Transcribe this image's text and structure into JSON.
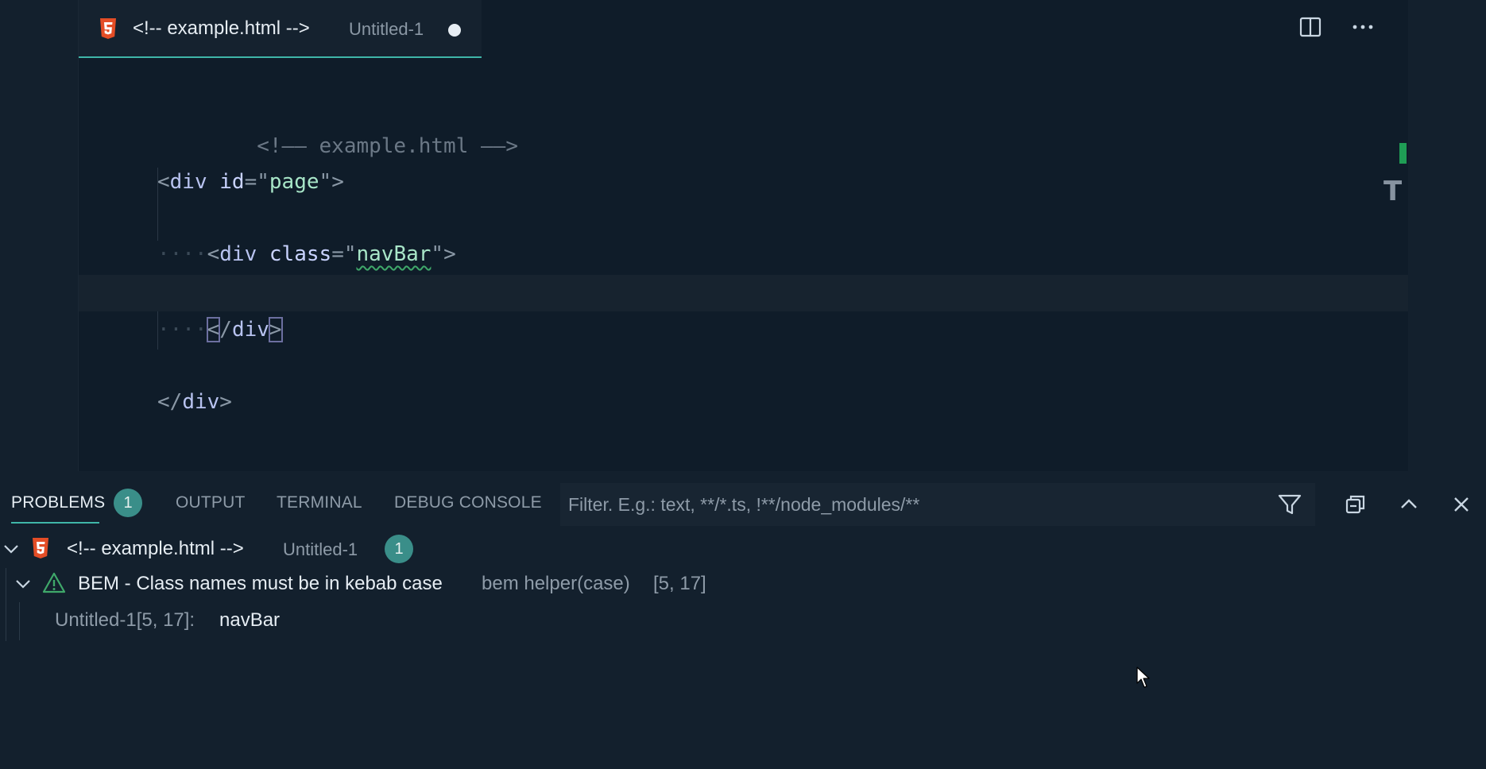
{
  "editor": {
    "tab": {
      "title": "<!-- example.html -->",
      "description": "Untitled-1",
      "icon": "html5-icon",
      "dirty": true
    },
    "toolbar": {
      "split_icon": "split-editor-icon",
      "more_icon": "more-actions-icon"
    },
    "code": {
      "line1": {
        "comment_open": "<!——",
        "comment_text": " example.html ",
        "comment_close": "——>"
      },
      "line3": {
        "lt": "<",
        "tag": "div",
        "sp": " ",
        "attr": "id",
        "eq": "=",
        "q1": "\"",
        "value": "page",
        "q2": "\"",
        "gt": ">"
      },
      "line5": {
        "ws": "····",
        "lt": "<",
        "tag": "div",
        "sp": " ",
        "attr": "class",
        "eq": "=",
        "q1": "\"",
        "value": "navBar",
        "q2": "\"",
        "gt": ">"
      },
      "line7": {
        "ws": "····",
        "lt": "<",
        "slash": "/",
        "tag": "div",
        "gt": ">"
      },
      "line9": {
        "lt": "<",
        "slash": "/",
        "tag": "div",
        "gt": ">"
      }
    },
    "overview_marks": {
      "text_icon": "T"
    }
  },
  "panel": {
    "tabs": [
      {
        "label": "PROBLEMS",
        "count": "1"
      },
      {
        "label": "OUTPUT"
      },
      {
        "label": "TERMINAL"
      },
      {
        "label": "DEBUG CONSOLE"
      }
    ],
    "filter": {
      "placeholder": "Filter. E.g.: text, **/*.ts, !**/node_modules/**",
      "value": ""
    },
    "actions": {
      "filter_icon": "filter-icon",
      "collapse_icon": "collapse-all-icon",
      "maximize_icon": "chevron-up-icon",
      "close_icon": "close-icon"
    },
    "problems": {
      "file": {
        "name": "<!-- example.html -->",
        "path": "Untitled-1",
        "count": "1"
      },
      "item": {
        "message": "BEM - Class names must be in kebab case",
        "source": "bem helper(case)",
        "position": "[5, 17]"
      },
      "detail": {
        "location": "Untitled-1[5, 17]:",
        "text": "navBar"
      }
    }
  },
  "colors": {
    "accent": "#3fb6a8",
    "badge": "#3a8e89",
    "warning": "#3fa86a",
    "html_icon": "#e44d26"
  }
}
